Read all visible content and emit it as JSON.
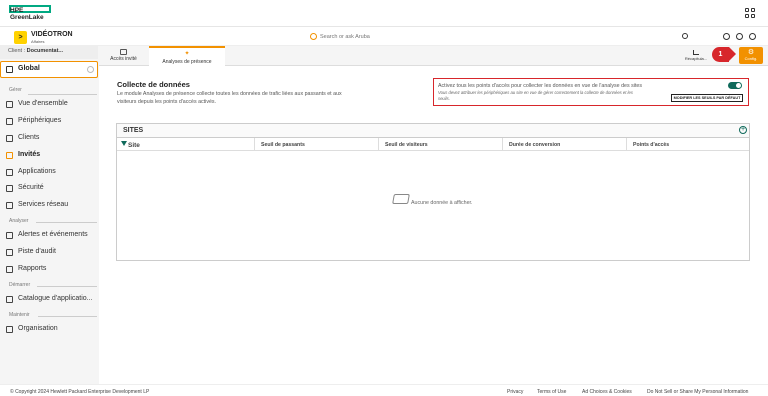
{
  "brand": {
    "hpe_line1": "HPE",
    "hpe_line2": "GreenLake",
    "accent": "#01a982"
  },
  "org": {
    "logo_letter": ">",
    "name": "VIDÉOTRON",
    "sub": "Affaires",
    "color": "#ffd200"
  },
  "search": {
    "placeholder": "Search or ask Aruba"
  },
  "client": {
    "label": "Client : ",
    "value": "Documentat..."
  },
  "tabs": [
    {
      "label": "Accès invité",
      "icon": "guest-access-icon"
    },
    {
      "label": "Analyses de présence",
      "icon": "presence-analytics-icon",
      "active": true
    }
  ],
  "toolbar": {
    "recap_label": "Récapitula...",
    "config_label": "Config.",
    "badge": "1",
    "accent": "#f29100",
    "badge_color": "#d7262b"
  },
  "sidebar": {
    "global": "Global",
    "sections": [
      "Gérer",
      "Analyser",
      "Démarrer",
      "Maintenir"
    ],
    "items": [
      {
        "label": "Vue d'ensemble",
        "icon": "overview-icon"
      },
      {
        "label": "Périphériques",
        "icon": "devices-icon"
      },
      {
        "label": "Clients",
        "icon": "clients-icon"
      },
      {
        "label": "Invités",
        "icon": "guests-icon",
        "active": true
      },
      {
        "label": "Applications",
        "icon": "applications-icon"
      },
      {
        "label": "Sécurité",
        "icon": "security-icon"
      },
      {
        "label": "Services réseau",
        "icon": "network-services-icon"
      },
      {
        "label": "Alertes et événements",
        "icon": "alerts-icon"
      },
      {
        "label": "Piste d'audit",
        "icon": "audit-trail-icon"
      },
      {
        "label": "Rapports",
        "icon": "reports-icon"
      },
      {
        "label": "Catalogue d'applicatio...",
        "icon": "app-catalog-icon"
      },
      {
        "label": "Organisation",
        "icon": "organisation-icon"
      }
    ]
  },
  "main": {
    "title": "Collecte de données",
    "description": "Le module Analyses de présence collecte toutes les données de trafic liées aux passants et aux visiteurs depuis les points d'accès activés.",
    "notice": {
      "line1": "Activez tous les points d'accès pour collecter les données en vue de l'analyse des sites",
      "line2": "Vous devez attribuer les périphériques au site en vue de gérer correctement la collecte de données et les seuils.",
      "button": "MODIFIER LES SEUILS PAR DÉFAUT",
      "toggle_on": true
    },
    "sites": {
      "title": "SITES",
      "columns": [
        "Site",
        "Seuil de passants",
        "Seuil de visiteurs",
        "Durée de conversion",
        "Points d'accès"
      ],
      "empty": "Aucune donnée à afficher."
    }
  },
  "footer": {
    "copyright": "© Copyright 2024 Hewlett Packard Enterprise Development LP",
    "links": [
      "Privacy",
      "Terms of Use",
      "Ad Choices & Cookies",
      "Do Not Sell or Share My Personal Information"
    ]
  }
}
